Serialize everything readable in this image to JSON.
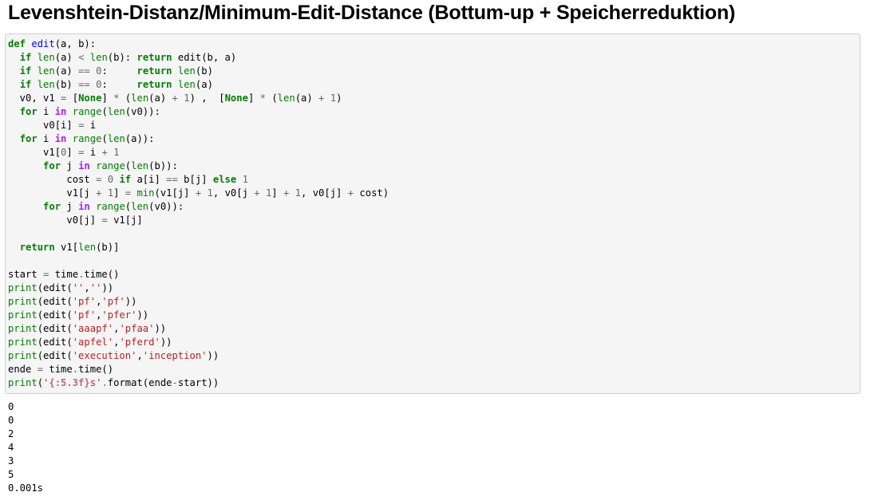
{
  "notebook": {
    "heading": "Levenshtein-Distanz/Minimum-Edit-Distance (Bottum-up + Speicherreduktion)",
    "code_lines": [
      [
        [
          "kw",
          "def"
        ],
        [
          "p",
          " "
        ],
        [
          "fn",
          "edit"
        ],
        [
          "p",
          "(a, b):"
        ]
      ],
      [
        [
          "p",
          "  "
        ],
        [
          "kw",
          "if"
        ],
        [
          "p",
          " "
        ],
        [
          "bi",
          "len"
        ],
        [
          "p",
          "(a) "
        ],
        [
          "op",
          "<"
        ],
        [
          "p",
          " "
        ],
        [
          "bi",
          "len"
        ],
        [
          "p",
          "(b): "
        ],
        [
          "kw",
          "return"
        ],
        [
          "p",
          " edit(b, a)"
        ]
      ],
      [
        [
          "p",
          "  "
        ],
        [
          "kw",
          "if"
        ],
        [
          "p",
          " "
        ],
        [
          "bi",
          "len"
        ],
        [
          "p",
          "(a) "
        ],
        [
          "op",
          "=="
        ],
        [
          "p",
          " "
        ],
        [
          "num",
          "0"
        ],
        [
          "p",
          ":     "
        ],
        [
          "kw",
          "return"
        ],
        [
          "p",
          " "
        ],
        [
          "bi",
          "len"
        ],
        [
          "p",
          "(b)"
        ]
      ],
      [
        [
          "p",
          "  "
        ],
        [
          "kw",
          "if"
        ],
        [
          "p",
          " "
        ],
        [
          "bi",
          "len"
        ],
        [
          "p",
          "(b) "
        ],
        [
          "op",
          "=="
        ],
        [
          "p",
          " "
        ],
        [
          "num",
          "0"
        ],
        [
          "p",
          ":     "
        ],
        [
          "kw",
          "return"
        ],
        [
          "p",
          " "
        ],
        [
          "bi",
          "len"
        ],
        [
          "p",
          "(a)"
        ]
      ],
      [
        [
          "p",
          "  v0, v1 "
        ],
        [
          "op",
          "="
        ],
        [
          "p",
          " ["
        ],
        [
          "kw",
          "None"
        ],
        [
          "p",
          "] "
        ],
        [
          "op",
          "*"
        ],
        [
          "p",
          " ("
        ],
        [
          "bi",
          "len"
        ],
        [
          "p",
          "(a) "
        ],
        [
          "op",
          "+"
        ],
        [
          "p",
          " "
        ],
        [
          "num",
          "1"
        ],
        [
          "p",
          ") ,  ["
        ],
        [
          "kw",
          "None"
        ],
        [
          "p",
          "] "
        ],
        [
          "op",
          "*"
        ],
        [
          "p",
          " ("
        ],
        [
          "bi",
          "len"
        ],
        [
          "p",
          "(a) "
        ],
        [
          "op",
          "+"
        ],
        [
          "p",
          " "
        ],
        [
          "num",
          "1"
        ],
        [
          "p",
          ")"
        ]
      ],
      [
        [
          "p",
          "  "
        ],
        [
          "kw",
          "for"
        ],
        [
          "p",
          " i "
        ],
        [
          "ow",
          "in"
        ],
        [
          "p",
          " "
        ],
        [
          "bi",
          "range"
        ],
        [
          "p",
          "("
        ],
        [
          "bi",
          "len"
        ],
        [
          "p",
          "(v0)):"
        ]
      ],
      [
        [
          "p",
          "      v0[i] "
        ],
        [
          "op",
          "="
        ],
        [
          "p",
          " i"
        ]
      ],
      [
        [
          "p",
          "  "
        ],
        [
          "kw",
          "for"
        ],
        [
          "p",
          " i "
        ],
        [
          "ow",
          "in"
        ],
        [
          "p",
          " "
        ],
        [
          "bi",
          "range"
        ],
        [
          "p",
          "("
        ],
        [
          "bi",
          "len"
        ],
        [
          "p",
          "(a)):"
        ]
      ],
      [
        [
          "p",
          "      v1["
        ],
        [
          "num",
          "0"
        ],
        [
          "p",
          "] "
        ],
        [
          "op",
          "="
        ],
        [
          "p",
          " i "
        ],
        [
          "op",
          "+"
        ],
        [
          "p",
          " "
        ],
        [
          "num",
          "1"
        ]
      ],
      [
        [
          "p",
          "      "
        ],
        [
          "kw",
          "for"
        ],
        [
          "p",
          " j "
        ],
        [
          "ow",
          "in"
        ],
        [
          "p",
          " "
        ],
        [
          "bi",
          "range"
        ],
        [
          "p",
          "("
        ],
        [
          "bi",
          "len"
        ],
        [
          "p",
          "(b)):"
        ]
      ],
      [
        [
          "p",
          "          cost "
        ],
        [
          "op",
          "="
        ],
        [
          "p",
          " "
        ],
        [
          "num",
          "0"
        ],
        [
          "p",
          " "
        ],
        [
          "kw",
          "if"
        ],
        [
          "p",
          " a[i] "
        ],
        [
          "op",
          "=="
        ],
        [
          "p",
          " b[j] "
        ],
        [
          "kw",
          "else"
        ],
        [
          "p",
          " "
        ],
        [
          "num",
          "1"
        ]
      ],
      [
        [
          "p",
          "          v1[j "
        ],
        [
          "op",
          "+"
        ],
        [
          "p",
          " "
        ],
        [
          "num",
          "1"
        ],
        [
          "p",
          "] "
        ],
        [
          "op",
          "="
        ],
        [
          "p",
          " "
        ],
        [
          "bi",
          "min"
        ],
        [
          "p",
          "(v1[j] "
        ],
        [
          "op",
          "+"
        ],
        [
          "p",
          " "
        ],
        [
          "num",
          "1"
        ],
        [
          "p",
          ", v0[j "
        ],
        [
          "op",
          "+"
        ],
        [
          "p",
          " "
        ],
        [
          "num",
          "1"
        ],
        [
          "p",
          "] "
        ],
        [
          "op",
          "+"
        ],
        [
          "p",
          " "
        ],
        [
          "num",
          "1"
        ],
        [
          "p",
          ", v0[j] "
        ],
        [
          "op",
          "+"
        ],
        [
          "p",
          " cost)"
        ]
      ],
      [
        [
          "p",
          "      "
        ],
        [
          "kw",
          "for"
        ],
        [
          "p",
          " j "
        ],
        [
          "ow",
          "in"
        ],
        [
          "p",
          " "
        ],
        [
          "bi",
          "range"
        ],
        [
          "p",
          "("
        ],
        [
          "bi",
          "len"
        ],
        [
          "p",
          "(v0)):"
        ]
      ],
      [
        [
          "p",
          "          v0[j] "
        ],
        [
          "op",
          "="
        ],
        [
          "p",
          " v1[j]"
        ]
      ],
      [
        [
          "p",
          ""
        ]
      ],
      [
        [
          "p",
          "  "
        ],
        [
          "kw",
          "return"
        ],
        [
          "p",
          " v1["
        ],
        [
          "bi",
          "len"
        ],
        [
          "p",
          "(b)]"
        ]
      ],
      [
        [
          "p",
          ""
        ]
      ],
      [
        [
          "p",
          "start "
        ],
        [
          "op",
          "="
        ],
        [
          "p",
          " time"
        ],
        [
          "op",
          "."
        ],
        [
          "p",
          "time()"
        ]
      ],
      [
        [
          "bi",
          "print"
        ],
        [
          "p",
          "(edit("
        ],
        [
          "str",
          "''"
        ],
        [
          "p",
          ","
        ],
        [
          "str",
          "''"
        ],
        [
          "p",
          "))"
        ]
      ],
      [
        [
          "bi",
          "print"
        ],
        [
          "p",
          "(edit("
        ],
        [
          "str",
          "'pf'"
        ],
        [
          "p",
          ","
        ],
        [
          "str",
          "'pf'"
        ],
        [
          "p",
          "))"
        ]
      ],
      [
        [
          "bi",
          "print"
        ],
        [
          "p",
          "(edit("
        ],
        [
          "str",
          "'pf'"
        ],
        [
          "p",
          ","
        ],
        [
          "str",
          "'pfer'"
        ],
        [
          "p",
          "))"
        ]
      ],
      [
        [
          "bi",
          "print"
        ],
        [
          "p",
          "(edit("
        ],
        [
          "str",
          "'aaapf'"
        ],
        [
          "p",
          ","
        ],
        [
          "str",
          "'pfaa'"
        ],
        [
          "p",
          "))"
        ]
      ],
      [
        [
          "bi",
          "print"
        ],
        [
          "p",
          "(edit("
        ],
        [
          "str",
          "'apfel'"
        ],
        [
          "p",
          ","
        ],
        [
          "str",
          "'pferd'"
        ],
        [
          "p",
          "))"
        ]
      ],
      [
        [
          "bi",
          "print"
        ],
        [
          "p",
          "(edit("
        ],
        [
          "str",
          "'execution'"
        ],
        [
          "p",
          ","
        ],
        [
          "str",
          "'inception'"
        ],
        [
          "p",
          "))"
        ]
      ],
      [
        [
          "p",
          "ende "
        ],
        [
          "op",
          "="
        ],
        [
          "p",
          " time"
        ],
        [
          "op",
          "."
        ],
        [
          "p",
          "time()"
        ]
      ],
      [
        [
          "bi",
          "print"
        ],
        [
          "p",
          "("
        ],
        [
          "str",
          "'"
        ],
        [
          "si",
          "{:5.3f}"
        ],
        [
          "str",
          "s'"
        ],
        [
          "op",
          "."
        ],
        [
          "p",
          "format(ende"
        ],
        [
          "op",
          "-"
        ],
        [
          "p",
          "start))"
        ]
      ]
    ],
    "output_lines": [
      "0",
      "0",
      "2",
      "4",
      "3",
      "5",
      "0.001s"
    ]
  },
  "colors": {
    "keyword": "#008000",
    "function_name": "#0000ff",
    "builtin": "#008000",
    "operator": "#666666",
    "operator_word": "#aa22ff",
    "string": "#ba2121",
    "string_interpolation": "#bb6688",
    "number": "#666666",
    "cell_background": "#f5f5f5",
    "cell_border": "#cfcfcf"
  }
}
